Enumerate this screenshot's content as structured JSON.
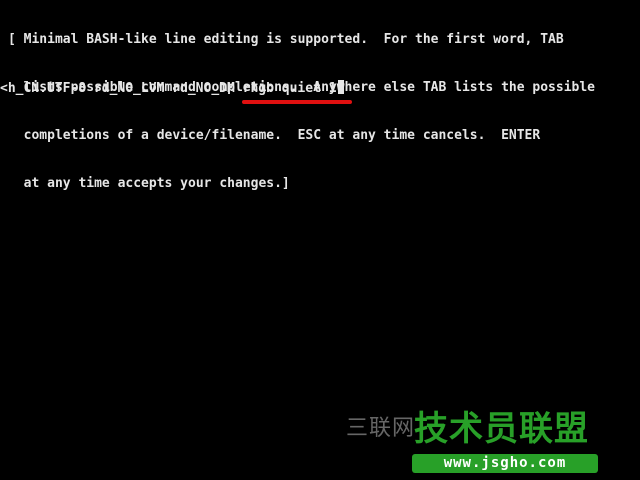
{
  "help": {
    "lines": [
      "[ Minimal BASH-like line editing is supported.  For the first word, TAB",
      "  lists possible command completions.  Anywhere else TAB lists the possible",
      "  completions of a device/filename.  ESC at any time cancels.  ENTER",
      "  at any time accepts your changes.]"
    ]
  },
  "command_line": {
    "text": "<h_CN.UTF-8 rd_NO_LVM rd_NO_DM rhgb quiet 1"
  },
  "watermark": {
    "prefix": "三联网",
    "main": "技术员联盟",
    "url": "www.jsgho.com"
  },
  "colors": {
    "background": "#000000",
    "text": "#e6e6e6",
    "highlight_underline": "#e01010",
    "watermark_green": "#28a028"
  }
}
